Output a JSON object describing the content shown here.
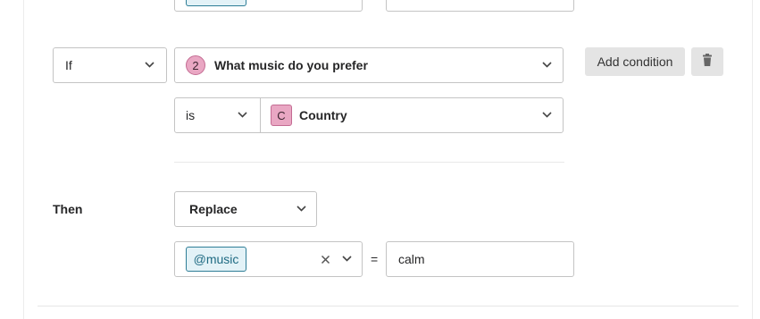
{
  "condition": {
    "operator": "If",
    "question": {
      "number": "2",
      "label": "What music do you prefer"
    },
    "comparator": "is",
    "choice": {
      "letter": "C",
      "label": "Country"
    },
    "add_condition_label": "Add condition",
    "delete_icon": "trash-icon"
  },
  "action": {
    "section_label": "Then",
    "type": "Replace",
    "variable": "@music",
    "clear_icon": "close-icon",
    "equals": "=",
    "value": "calm"
  }
}
